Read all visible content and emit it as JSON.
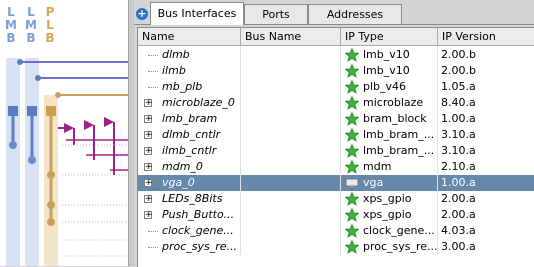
{
  "left_panel": {
    "bus_labels": [
      {
        "letters": [
          "L",
          "M",
          "B"
        ],
        "color": "#7aa0d8"
      },
      {
        "letters": [
          "L",
          "M",
          "B"
        ],
        "color": "#7aa0d8"
      },
      {
        "letters": [
          "P",
          "L",
          "B"
        ],
        "color": "#d8b66a"
      }
    ]
  },
  "tabs": [
    {
      "label": "Bus Interfaces",
      "active": true
    },
    {
      "label": "Ports",
      "active": false
    },
    {
      "label": "Addresses",
      "active": false
    }
  ],
  "columns": [
    "Name",
    "Bus Name",
    "IP Type",
    "IP Version"
  ],
  "rows": [
    {
      "name": "dlmb",
      "bus": "",
      "type": "lmb_v10",
      "version": "2.00.b",
      "expandable": false,
      "selected": false,
      "icon": "star-icon"
    },
    {
      "name": "ilmb",
      "bus": "",
      "type": "lmb_v10",
      "version": "2.00.b",
      "expandable": false,
      "selected": false,
      "icon": "star-icon"
    },
    {
      "name": "mb_plb",
      "bus": "",
      "type": "plb_v46",
      "version": "1.05.a",
      "expandable": false,
      "selected": false,
      "icon": "star-icon"
    },
    {
      "name": "microblaze_0",
      "bus": "",
      "type": "microblaze",
      "version": "8.40.a",
      "expandable": true,
      "selected": false,
      "icon": "star-icon"
    },
    {
      "name": "lmb_bram",
      "bus": "",
      "type": "bram_block",
      "version": "1.00.a",
      "expandable": true,
      "selected": false,
      "icon": "star-icon"
    },
    {
      "name": "dlmb_cntlr",
      "bus": "",
      "type": "lmb_bram_...",
      "version": "3.10.a",
      "expandable": true,
      "selected": false,
      "icon": "star-icon"
    },
    {
      "name": "ilmb_cntlr",
      "bus": "",
      "type": "lmb_bram_...",
      "version": "3.10.a",
      "expandable": true,
      "selected": false,
      "icon": "star-icon"
    },
    {
      "name": "mdm_0",
      "bus": "",
      "type": "mdm",
      "version": "2.10.a",
      "expandable": true,
      "selected": false,
      "icon": "star-icon"
    },
    {
      "name": "vga_0",
      "bus": "",
      "type": "vga",
      "version": "1.00.a",
      "expandable": true,
      "selected": true,
      "icon": "user-ip-icon"
    },
    {
      "name": "LEDs_8Bits",
      "bus": "",
      "type": "xps_gpio",
      "version": "2.00.a",
      "expandable": true,
      "selected": false,
      "icon": "star-icon"
    },
    {
      "name": "Push_Butto...",
      "bus": "",
      "type": "xps_gpio",
      "version": "2.00.a",
      "expandable": true,
      "selected": false,
      "icon": "star-icon"
    },
    {
      "name": "clock_gene...",
      "bus": "",
      "type": "clock_gene...",
      "version": "4.03.a",
      "expandable": false,
      "selected": false,
      "icon": "star-icon"
    },
    {
      "name": "proc_sys_re...",
      "bus": "",
      "type": "proc_sys_re...",
      "version": "3.00.a",
      "expandable": false,
      "selected": false,
      "icon": "star-icon"
    }
  ]
}
